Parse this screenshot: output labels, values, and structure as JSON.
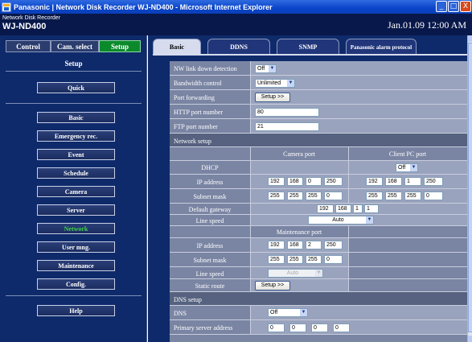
{
  "window": {
    "title": "Panasonic | Network Disk Recorder WJ-ND400 - Microsoft Internet Explorer",
    "min": "_",
    "max": "□",
    "close": "X"
  },
  "header": {
    "subtitle": "Network Disk Recorder",
    "model": "WJ-ND400",
    "datetime": "Jan.01.09  12:00  AM"
  },
  "sidebar": {
    "modes": [
      "Control",
      "Cam. select",
      "Setup"
    ],
    "active_mode": "Setup",
    "title": "Setup",
    "quick": "Quick",
    "items": [
      "Basic",
      "Emergency rec.",
      "Event",
      "Schedule",
      "Camera",
      "Server",
      "Network",
      "User mng.",
      "Maintenance",
      "Config."
    ],
    "active_item": "Network",
    "help": "Help"
  },
  "tabs": [
    "Basic",
    "DDNS",
    "SNMP",
    "Panasonic alarm protocol"
  ],
  "active_tab": "Basic",
  "form": {
    "nw_link_down": {
      "label": "NW link down detection",
      "value": "Off"
    },
    "bandwidth": {
      "label": "Bandwidth control",
      "value": "Unlimited"
    },
    "port_forwarding": {
      "label": "Port forwarding",
      "button": "Setup >>"
    },
    "http_port": {
      "label": "HTTP port number",
      "value": "80"
    },
    "ftp_port": {
      "label": "FTP port number",
      "value": "21"
    },
    "network_setup": {
      "title": "Network setup",
      "camera_port": "Camera port",
      "client_port": "Client PC port",
      "dhcp": {
        "label": "DHCP",
        "client_value": "Off"
      },
      "ip": {
        "label": "IP address",
        "camera": [
          "192",
          "168",
          "0",
          "250"
        ],
        "client": [
          "192",
          "168",
          "1",
          "250"
        ]
      },
      "subnet": {
        "label": "Subnet mask",
        "camera": [
          "255",
          "255",
          "255",
          "0"
        ],
        "client": [
          "255",
          "255",
          "255",
          "0"
        ]
      },
      "gateway": {
        "label": "Default gateway",
        "value": [
          "192",
          "168",
          "1",
          "1"
        ]
      },
      "line_speed": {
        "label": "Line speed",
        "value": "Auto"
      },
      "maintenance_port": "Maintenance port",
      "m_ip": {
        "label": "IP address",
        "value": [
          "192",
          "168",
          "2",
          "250"
        ]
      },
      "m_subnet": {
        "label": "Subnet mask",
        "value": [
          "255",
          "255",
          "255",
          "0"
        ]
      },
      "m_line_speed": {
        "label": "Line speed",
        "value": "Auto"
      },
      "static_route": {
        "label": "Static route",
        "button": "Setup >>"
      }
    },
    "dns_setup": {
      "title": "DNS setup",
      "dns": {
        "label": "DNS",
        "value": "Off"
      },
      "primary": {
        "label": "Primary server address",
        "value": [
          "0",
          "0",
          "0",
          "0"
        ]
      }
    }
  }
}
